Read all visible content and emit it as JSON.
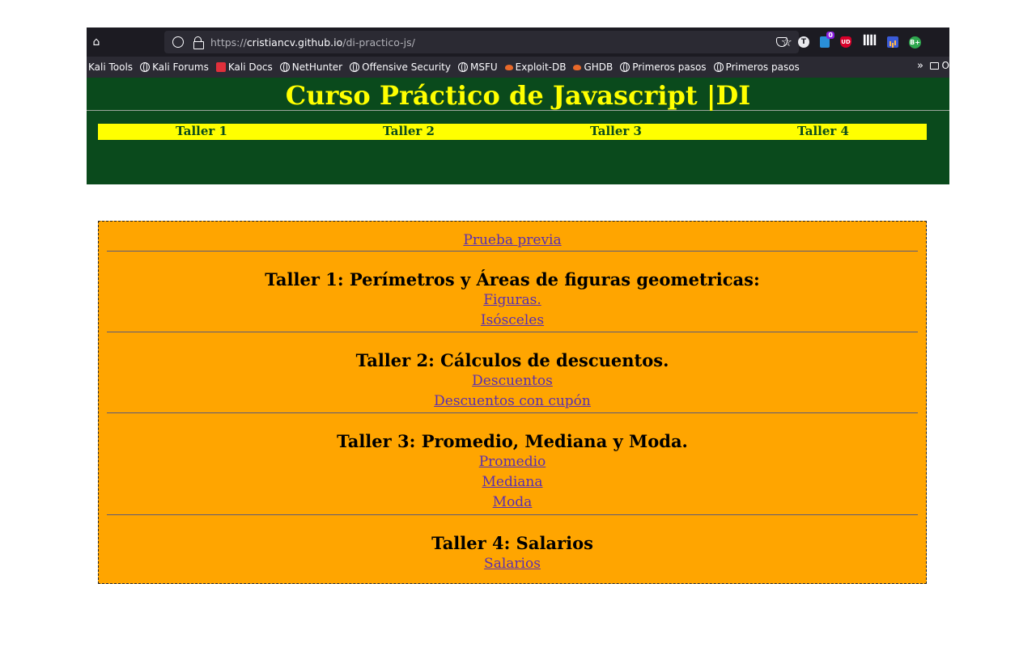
{
  "browser": {
    "url_prefix": "https://",
    "url_host": "cristiancv.github.io",
    "url_path": "/di-practico-js/",
    "home_icon": "home-icon",
    "star_icon": "bookmark-star-icon",
    "extensions": {
      "pv_badge": "0",
      "t_label": "T",
      "ub_label": "UD",
      "bplus_label": "B+"
    },
    "bookmarks": [
      {
        "label": "Kali Tools",
        "icon": "none"
      },
      {
        "label": "Kali Forums",
        "icon": "globe"
      },
      {
        "label": "Kali Docs",
        "icon": "kali"
      },
      {
        "label": "NetHunter",
        "icon": "globe"
      },
      {
        "label": "Offensive Security",
        "icon": "globe"
      },
      {
        "label": "MSFU",
        "icon": "globe"
      },
      {
        "label": "Exploit-DB",
        "icon": "exploit"
      },
      {
        "label": "GHDB",
        "icon": "exploit"
      },
      {
        "label": "Primeros pasos",
        "icon": "globe"
      },
      {
        "label": "Primeros pasos",
        "icon": "globe"
      }
    ],
    "overflow_label": "»",
    "other_folder_label": "O"
  },
  "header": {
    "title": "Curso Práctico de Javascript |DI",
    "nav": [
      "Taller 1",
      "Taller 2",
      "Taller 3",
      "Taller 4"
    ]
  },
  "content": {
    "preview_link": "Prueba previa",
    "sections": [
      {
        "title": "Taller 1: Perímetros y Áreas de figuras geometricas:",
        "links": [
          "Figuras.",
          "Isósceles"
        ]
      },
      {
        "title": "Taller 2: Cálculos de descuentos.",
        "links": [
          "Descuentos",
          "Descuentos con cupón"
        ]
      },
      {
        "title": "Taller 3: Promedio, Mediana y Moda.",
        "links": [
          "Promedio",
          "Mediana",
          "Moda"
        ]
      },
      {
        "title": "Taller 4: Salarios",
        "links": [
          "Salarios"
        ]
      }
    ]
  },
  "colors": {
    "header_bg": "#0a4a1c",
    "title_color": "#ffff00",
    "nav_bg": "#ffff00",
    "content_bg": "#ffa500",
    "link_color": "#5a2fb0"
  }
}
